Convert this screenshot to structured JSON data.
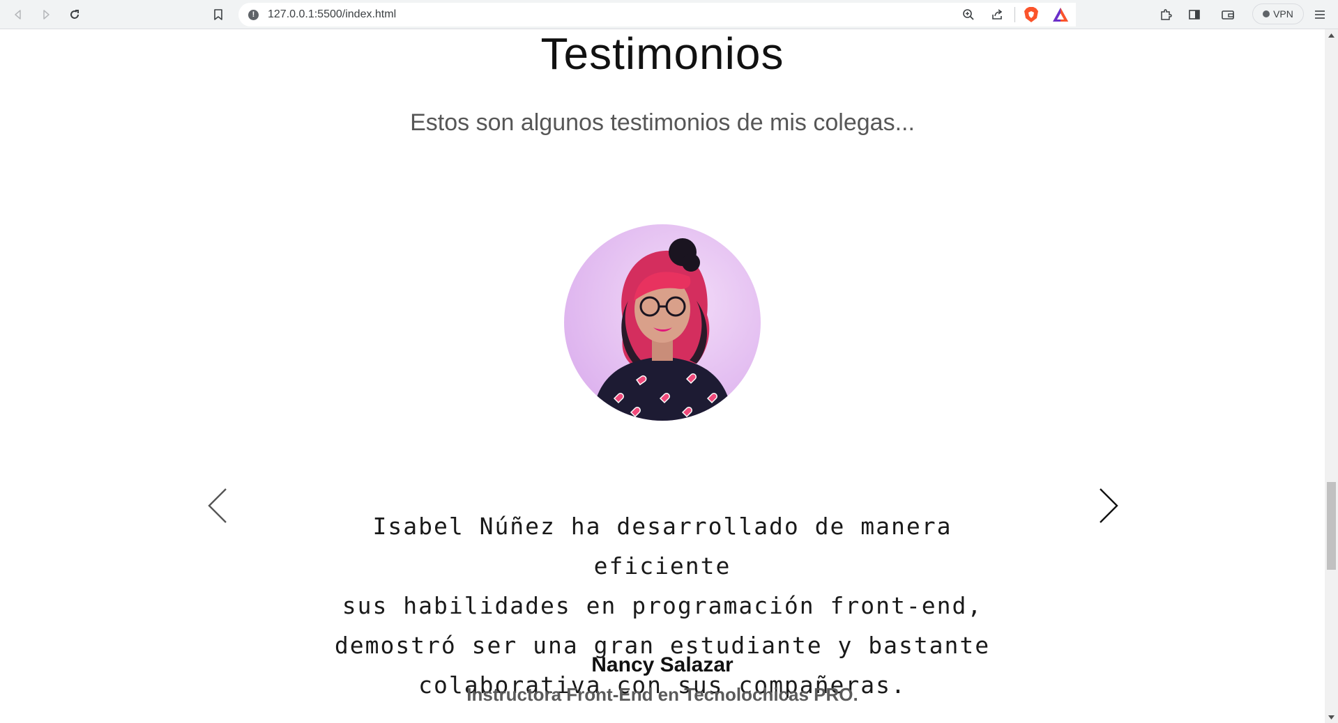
{
  "browser": {
    "url": "127.0.0.1:5500/index.html",
    "vpn_label": "VPN"
  },
  "section": {
    "title": "Testimonios",
    "subtitle": "Estos son algunos testimonios de mis colegas..."
  },
  "testimonial": {
    "quote_lines": [
      "Isabel Núñez ha desarrollado de manera eficiente",
      "sus habilidades en programación front-end,",
      "demostró ser una gran estudiante y bastante",
      "colaborativa con sus compañeras."
    ],
    "author": "Nancy Salazar",
    "role": "Instructora Front-End en Tecnolochicas PRO."
  },
  "icons": {
    "back": "back-arrow-icon",
    "forward": "forward-arrow-icon",
    "reload": "reload-icon",
    "bookmark": "bookmark-icon",
    "site_info": "info-icon",
    "zoom": "zoom-icon",
    "share": "share-icon",
    "brave": "brave-shield-icon",
    "rewards": "brave-rewards-icon",
    "extensions": "puzzle-icon",
    "sidebar": "sidebar-icon",
    "wallet": "wallet-icon",
    "menu": "hamburger-menu-icon",
    "prev": "chevron-left-icon",
    "next": "chevron-right-icon"
  },
  "colors": {
    "brave_orange": "#fb542b",
    "rewards_purple": "#6b2fc8",
    "avatar_bg": "#e7c4f2",
    "hair": "#e8325f",
    "shirt": "#1d1b33"
  }
}
